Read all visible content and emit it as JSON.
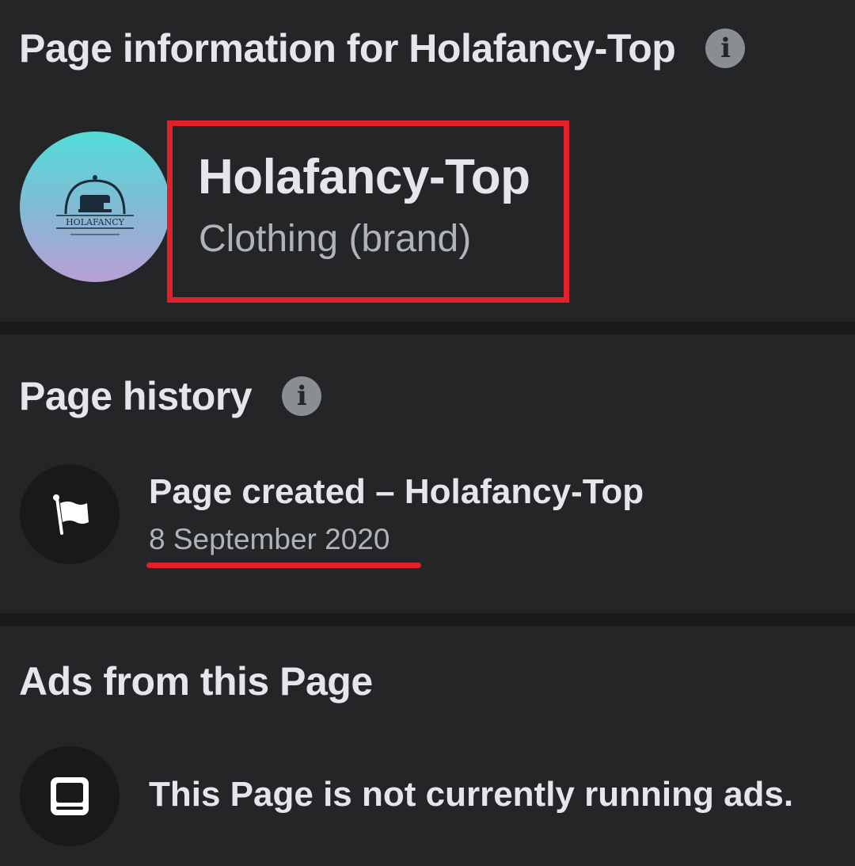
{
  "page_info": {
    "heading": "Page information for Holafancy-Top",
    "page_name": "Holafancy-Top",
    "category": "Clothing (brand)",
    "avatar_icon": "sewing-machine-logo",
    "avatar_text": "HOLAFANCY",
    "highlight_color": "#e0202a"
  },
  "history": {
    "heading": "Page history",
    "event": "Page created – Holafancy-Top",
    "date": "8 September 2020",
    "icon": "flag-icon"
  },
  "ads": {
    "heading": "Ads from this Page",
    "status": "This Page is not currently running ads.",
    "icon": "monitor-icon"
  },
  "info_glyph": "i",
  "colors": {
    "background": "#18191a",
    "card": "#242526",
    "primary_text": "#e4e6eb",
    "secondary_text": "#b0b3b8",
    "annotation_red": "#e0202a"
  }
}
